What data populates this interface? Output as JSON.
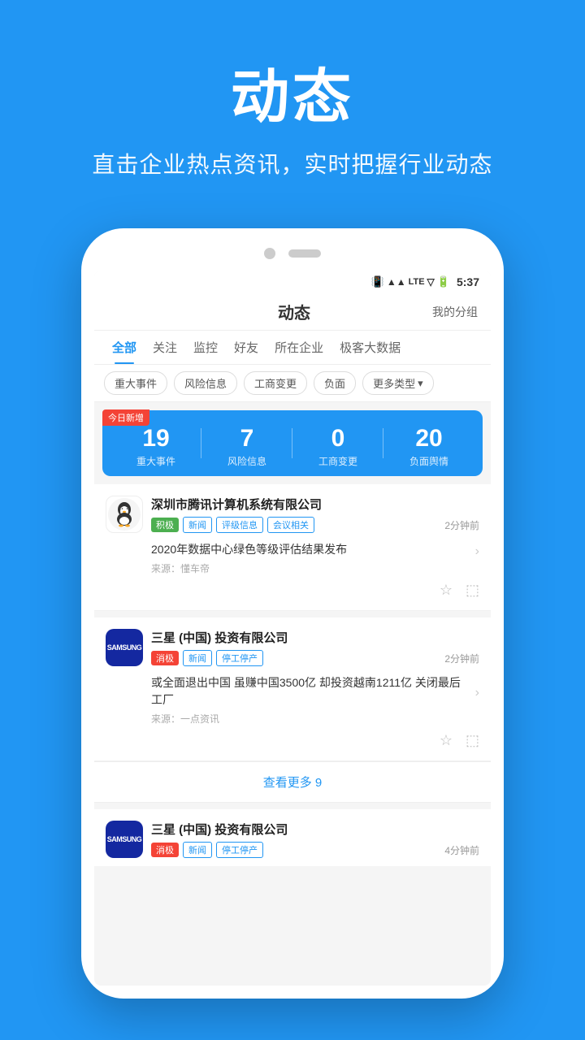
{
  "hero": {
    "title": "动态",
    "subtitle": "直击企业热点资讯，实时把握行业动态"
  },
  "status_bar": {
    "time": "5:37",
    "icons": "📶 LTE 🔋"
  },
  "app_header": {
    "title": "动态",
    "right_text": "我的分组"
  },
  "tabs": [
    {
      "label": "全部",
      "active": true
    },
    {
      "label": "关注",
      "active": false
    },
    {
      "label": "监控",
      "active": false
    },
    {
      "label": "好友",
      "active": false
    },
    {
      "label": "所在企业",
      "active": false
    },
    {
      "label": "极客大数据",
      "active": false
    }
  ],
  "filter_chips": [
    {
      "label": "重大事件"
    },
    {
      "label": "风险信息"
    },
    {
      "label": "工商变更"
    },
    {
      "label": "负面"
    },
    {
      "label": "更多类型 ▾"
    }
  ],
  "stats_card": {
    "today_badge": "今日新增",
    "items": [
      {
        "number": "19",
        "label": "重大事件"
      },
      {
        "number": "7",
        "label": "风险信息"
      },
      {
        "number": "0",
        "label": "工商变更"
      },
      {
        "number": "20",
        "label": "负面舆情"
      }
    ]
  },
  "news_items": [
    {
      "company": "深圳市腾讯计算机系统有限公司",
      "status": "积极",
      "status_type": "positive",
      "tags": [
        "新闻",
        "评级信息",
        "会议相关"
      ],
      "time": "2分钟前",
      "title": "2020年数据中心绿色等级评估结果发布",
      "source": "来源：懂车帝"
    },
    {
      "company": "三星 (中国) 投资有限公司",
      "status": "消极",
      "status_type": "negative",
      "tags": [
        "新闻",
        "停工停产"
      ],
      "time": "2分钟前",
      "title": "或全面退出中国 虽赚中国3500亿 却投资越南1211亿 关闭最后工厂",
      "source": "来源：一点资讯"
    }
  ],
  "see_more": {
    "text": "查看更多 9"
  },
  "partial_item": {
    "company": "三星 (中国) 投资有限公司",
    "tags": [
      "消极",
      "新闻",
      "停工停产"
    ],
    "time": "4分钟前"
  }
}
